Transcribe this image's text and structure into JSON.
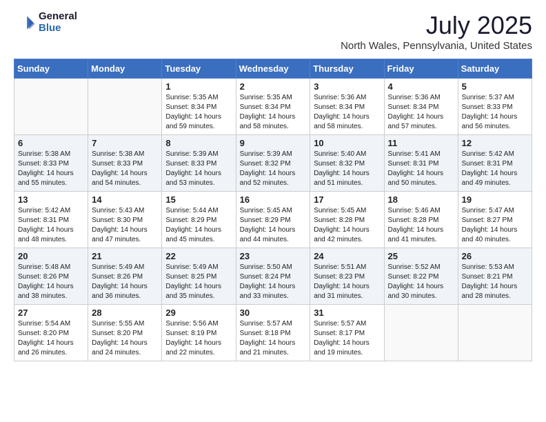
{
  "header": {
    "logo_general": "General",
    "logo_blue": "Blue",
    "month_title": "July 2025",
    "location": "North Wales, Pennsylvania, United States"
  },
  "weekdays": [
    "Sunday",
    "Monday",
    "Tuesday",
    "Wednesday",
    "Thursday",
    "Friday",
    "Saturday"
  ],
  "weeks": [
    [
      {
        "day": "",
        "sunrise": "",
        "sunset": "",
        "daylight": ""
      },
      {
        "day": "",
        "sunrise": "",
        "sunset": "",
        "daylight": ""
      },
      {
        "day": "1",
        "sunrise": "Sunrise: 5:35 AM",
        "sunset": "Sunset: 8:34 PM",
        "daylight": "Daylight: 14 hours and 59 minutes."
      },
      {
        "day": "2",
        "sunrise": "Sunrise: 5:35 AM",
        "sunset": "Sunset: 8:34 PM",
        "daylight": "Daylight: 14 hours and 58 minutes."
      },
      {
        "day": "3",
        "sunrise": "Sunrise: 5:36 AM",
        "sunset": "Sunset: 8:34 PM",
        "daylight": "Daylight: 14 hours and 58 minutes."
      },
      {
        "day": "4",
        "sunrise": "Sunrise: 5:36 AM",
        "sunset": "Sunset: 8:34 PM",
        "daylight": "Daylight: 14 hours and 57 minutes."
      },
      {
        "day": "5",
        "sunrise": "Sunrise: 5:37 AM",
        "sunset": "Sunset: 8:33 PM",
        "daylight": "Daylight: 14 hours and 56 minutes."
      }
    ],
    [
      {
        "day": "6",
        "sunrise": "Sunrise: 5:38 AM",
        "sunset": "Sunset: 8:33 PM",
        "daylight": "Daylight: 14 hours and 55 minutes."
      },
      {
        "day": "7",
        "sunrise": "Sunrise: 5:38 AM",
        "sunset": "Sunset: 8:33 PM",
        "daylight": "Daylight: 14 hours and 54 minutes."
      },
      {
        "day": "8",
        "sunrise": "Sunrise: 5:39 AM",
        "sunset": "Sunset: 8:33 PM",
        "daylight": "Daylight: 14 hours and 53 minutes."
      },
      {
        "day": "9",
        "sunrise": "Sunrise: 5:39 AM",
        "sunset": "Sunset: 8:32 PM",
        "daylight": "Daylight: 14 hours and 52 minutes."
      },
      {
        "day": "10",
        "sunrise": "Sunrise: 5:40 AM",
        "sunset": "Sunset: 8:32 PM",
        "daylight": "Daylight: 14 hours and 51 minutes."
      },
      {
        "day": "11",
        "sunrise": "Sunrise: 5:41 AM",
        "sunset": "Sunset: 8:31 PM",
        "daylight": "Daylight: 14 hours and 50 minutes."
      },
      {
        "day": "12",
        "sunrise": "Sunrise: 5:42 AM",
        "sunset": "Sunset: 8:31 PM",
        "daylight": "Daylight: 14 hours and 49 minutes."
      }
    ],
    [
      {
        "day": "13",
        "sunrise": "Sunrise: 5:42 AM",
        "sunset": "Sunset: 8:31 PM",
        "daylight": "Daylight: 14 hours and 48 minutes."
      },
      {
        "day": "14",
        "sunrise": "Sunrise: 5:43 AM",
        "sunset": "Sunset: 8:30 PM",
        "daylight": "Daylight: 14 hours and 47 minutes."
      },
      {
        "day": "15",
        "sunrise": "Sunrise: 5:44 AM",
        "sunset": "Sunset: 8:29 PM",
        "daylight": "Daylight: 14 hours and 45 minutes."
      },
      {
        "day": "16",
        "sunrise": "Sunrise: 5:45 AM",
        "sunset": "Sunset: 8:29 PM",
        "daylight": "Daylight: 14 hours and 44 minutes."
      },
      {
        "day": "17",
        "sunrise": "Sunrise: 5:45 AM",
        "sunset": "Sunset: 8:28 PM",
        "daylight": "Daylight: 14 hours and 42 minutes."
      },
      {
        "day": "18",
        "sunrise": "Sunrise: 5:46 AM",
        "sunset": "Sunset: 8:28 PM",
        "daylight": "Daylight: 14 hours and 41 minutes."
      },
      {
        "day": "19",
        "sunrise": "Sunrise: 5:47 AM",
        "sunset": "Sunset: 8:27 PM",
        "daylight": "Daylight: 14 hours and 40 minutes."
      }
    ],
    [
      {
        "day": "20",
        "sunrise": "Sunrise: 5:48 AM",
        "sunset": "Sunset: 8:26 PM",
        "daylight": "Daylight: 14 hours and 38 minutes."
      },
      {
        "day": "21",
        "sunrise": "Sunrise: 5:49 AM",
        "sunset": "Sunset: 8:26 PM",
        "daylight": "Daylight: 14 hours and 36 minutes."
      },
      {
        "day": "22",
        "sunrise": "Sunrise: 5:49 AM",
        "sunset": "Sunset: 8:25 PM",
        "daylight": "Daylight: 14 hours and 35 minutes."
      },
      {
        "day": "23",
        "sunrise": "Sunrise: 5:50 AM",
        "sunset": "Sunset: 8:24 PM",
        "daylight": "Daylight: 14 hours and 33 minutes."
      },
      {
        "day": "24",
        "sunrise": "Sunrise: 5:51 AM",
        "sunset": "Sunset: 8:23 PM",
        "daylight": "Daylight: 14 hours and 31 minutes."
      },
      {
        "day": "25",
        "sunrise": "Sunrise: 5:52 AM",
        "sunset": "Sunset: 8:22 PM",
        "daylight": "Daylight: 14 hours and 30 minutes."
      },
      {
        "day": "26",
        "sunrise": "Sunrise: 5:53 AM",
        "sunset": "Sunset: 8:21 PM",
        "daylight": "Daylight: 14 hours and 28 minutes."
      }
    ],
    [
      {
        "day": "27",
        "sunrise": "Sunrise: 5:54 AM",
        "sunset": "Sunset: 8:20 PM",
        "daylight": "Daylight: 14 hours and 26 minutes."
      },
      {
        "day": "28",
        "sunrise": "Sunrise: 5:55 AM",
        "sunset": "Sunset: 8:20 PM",
        "daylight": "Daylight: 14 hours and 24 minutes."
      },
      {
        "day": "29",
        "sunrise": "Sunrise: 5:56 AM",
        "sunset": "Sunset: 8:19 PM",
        "daylight": "Daylight: 14 hours and 22 minutes."
      },
      {
        "day": "30",
        "sunrise": "Sunrise: 5:57 AM",
        "sunset": "Sunset: 8:18 PM",
        "daylight": "Daylight: 14 hours and 21 minutes."
      },
      {
        "day": "31",
        "sunrise": "Sunrise: 5:57 AM",
        "sunset": "Sunset: 8:17 PM",
        "daylight": "Daylight: 14 hours and 19 minutes."
      },
      {
        "day": "",
        "sunrise": "",
        "sunset": "",
        "daylight": ""
      },
      {
        "day": "",
        "sunrise": "",
        "sunset": "",
        "daylight": ""
      }
    ]
  ]
}
